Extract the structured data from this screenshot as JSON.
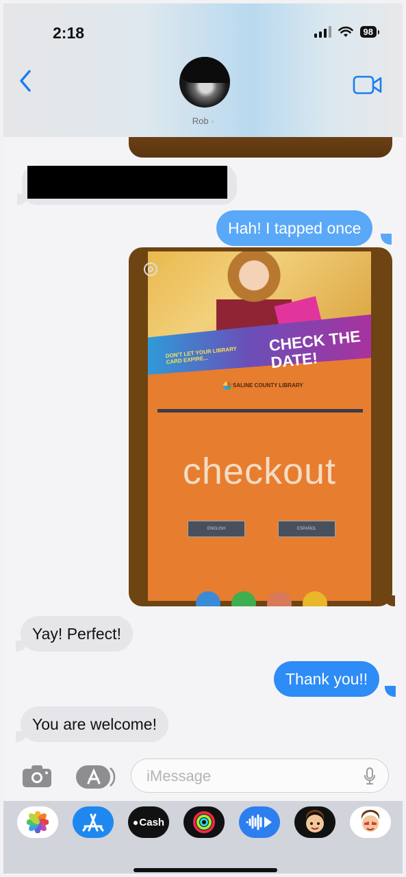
{
  "status_bar": {
    "time": "2:18",
    "battery": "98"
  },
  "header": {
    "contact_name": "Rob",
    "chevron": "›"
  },
  "messages": {
    "sent_1": "Hah! I tapped once",
    "photo": {
      "banner_small": "DON'T LET YOUR LIBRARY CARD EXPIRE...",
      "banner_big": "CHECK THE DATE!",
      "library_name": "SALINE COUNTY LIBRARY",
      "screen_word": "checkout",
      "button_left": "ENGLISH",
      "button_right": "ESPAÑOL"
    },
    "received_1": "Yay! Perfect!",
    "sent_2": "Thank you!!",
    "received_2": "You are welcome!"
  },
  "input": {
    "placeholder": "iMessage"
  },
  "apps": [
    "photos-icon",
    "app-store-icon",
    "apple-cash-icon",
    "fitness-icon",
    "audio-message-icon",
    "memoji-icon",
    "memoji-icon-2"
  ],
  "apps_labels": {
    "cash": "Cash"
  },
  "colors": {
    "accent": "#1a7cf3",
    "sent_bubble": "#2d8cf6",
    "received_bubble": "#e5e5ea"
  }
}
